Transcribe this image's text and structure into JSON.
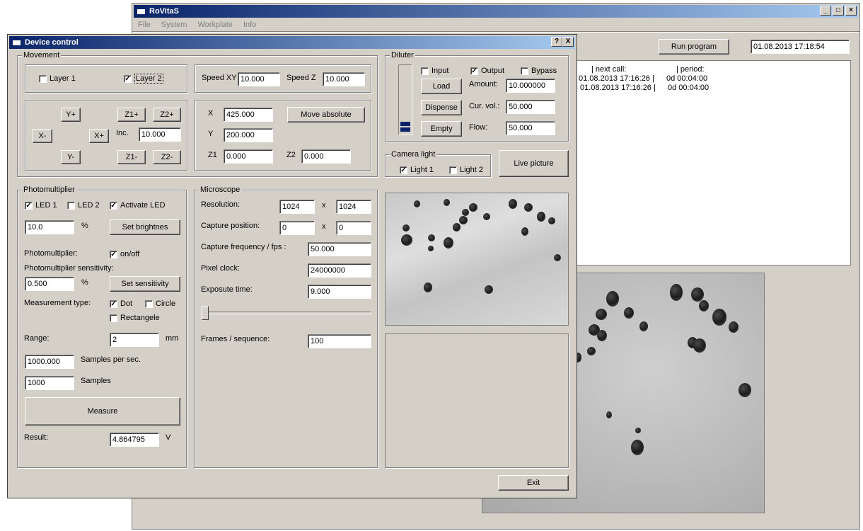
{
  "main_window": {
    "title": "RoVitaS",
    "menu": [
      "File",
      "System",
      "Workplate",
      "Info"
    ],
    "run_program_label": "Run program",
    "datetime": "01.08.2013  17:18:54",
    "log": {
      "headers": {
        "next_call": "| next call:",
        "period": "| period:"
      },
      "rows": [
        {
          "next_call": "01.08.2013   17:16:26 |",
          "period": "0d 00:04:00"
        },
        {
          "next_call": "01.08.2013   17:16:26 |",
          "period": "0d 00:04:00"
        }
      ]
    }
  },
  "device_control": {
    "title": "Device control",
    "help_btn": "?",
    "close_btn": "X",
    "movement": {
      "label": "Movement",
      "layer1": "Layer 1",
      "layer2": "Layer 2",
      "speed_xy_label": "Speed XY",
      "speed_xy": "10.000",
      "speed_z_label": "Speed Z",
      "speed_z": "10.000",
      "y_plus": "Y+",
      "y_minus": "Y-",
      "x_minus": "X-",
      "x_plus": "X+",
      "z1_plus": "Z1+",
      "z2_plus": "Z2+",
      "z1_minus": "Z1-",
      "z2_minus": "Z2-",
      "inc_label": "Inc.",
      "inc": "10.000",
      "x_label": "X",
      "x": "425.000",
      "y_label": "Y",
      "y": "200.000",
      "z1_label": "Z1",
      "z1": "0.000",
      "z2_label": "Z2",
      "z2": "0.000",
      "move_absolute": "Move absolute"
    },
    "diluter": {
      "label": "Diluter",
      "input": "Input",
      "output": "Output",
      "bypass": "Bypass",
      "load": "Load",
      "dispense": "Dispense",
      "empty": "Empty",
      "amount_label": "Amount:",
      "amount": "10.000000",
      "cur_vol_label": "Cur. vol.:",
      "cur_vol": "50.000",
      "flow_label": "Flow:",
      "flow": "50.000"
    },
    "camera_light": {
      "label": "Camera light",
      "light1": "Light 1",
      "light2": "Light 2",
      "live_picture": "Live picture"
    },
    "photomultiplier": {
      "label": "Photomultiplier",
      "led1": "LED 1",
      "led2": "LED 2",
      "activate_led": "Activate LED",
      "brightness": "10.0",
      "percent": "%",
      "set_brightness": "Set brightnes",
      "pm_label": "Photomultiplier:",
      "on_off": "on/off",
      "sensitivity_label": "Photomultiplier sensitivity:",
      "sensitivity": "0.500",
      "percent2": "%",
      "set_sensitivity": "Set sensitivity",
      "measurement_type_label": "Measurement type:",
      "dot": "Dot",
      "circle": "Circle",
      "rectangle": "Rectangele",
      "range_label": "Range:",
      "range": "2",
      "mm": "mm",
      "samples_per_sec": "1000.000",
      "samples_per_sec_label": "Samples per sec.",
      "samples": "1000",
      "samples_label": "Samples",
      "measure": "Measure",
      "result_label": "Result:",
      "result": "4.864795",
      "volt": "V"
    },
    "microscope": {
      "label": "Microscope",
      "resolution_label": "Resolution:",
      "res_w": "1024",
      "res_x": "x",
      "res_h": "1024",
      "capture_position_label": "Capture position:",
      "cap_x": "0",
      "cap_sep": "x",
      "cap_y": "0",
      "fps_label": "Capture frequency / fps :",
      "fps": "50.000",
      "pixel_clock_label": "Pixel clock:",
      "pixel_clock": "24000000",
      "exposure_label": "Exposute time:",
      "exposure": "9.000",
      "frames_label": "Frames / sequence:",
      "frames": "100"
    },
    "exit": "Exit"
  }
}
